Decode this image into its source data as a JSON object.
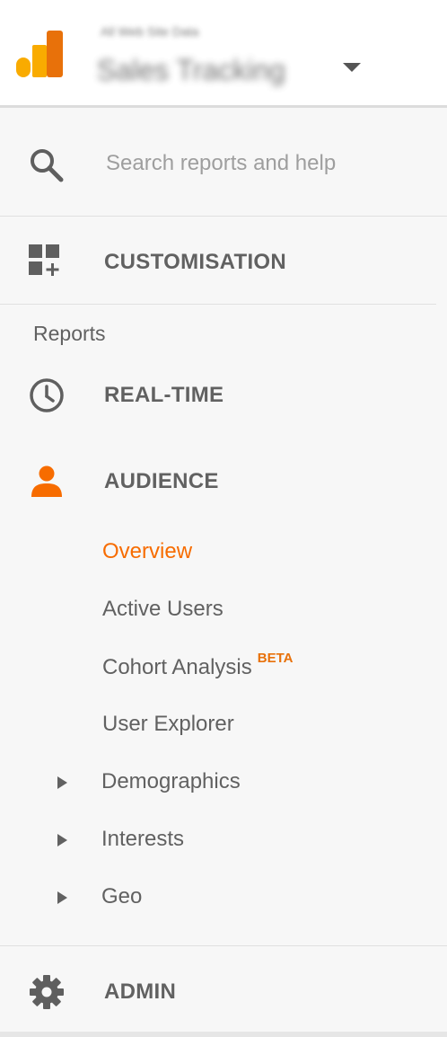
{
  "header": {
    "account_line": "All Web Site Data",
    "property_name": "Sales Tracking",
    "logo_icon": "analytics-logo-icon",
    "dropdown_icon": "caret-down-icon"
  },
  "search": {
    "placeholder": "Search reports and help",
    "icon": "search-icon"
  },
  "nav": {
    "customisation": {
      "label": "CUSTOMISATION",
      "icon": "dashboard-add-icon"
    },
    "reports_section": "Reports",
    "realtime": {
      "label": "REAL-TIME",
      "icon": "clock-icon"
    },
    "audience": {
      "label": "AUDIENCE",
      "icon": "person-icon",
      "items": [
        {
          "label": "Overview",
          "active": true
        },
        {
          "label": "Active Users"
        },
        {
          "label": "Cohort Analysis",
          "badge": "BETA"
        },
        {
          "label": "User Explorer"
        },
        {
          "label": "Demographics",
          "expandable": true
        },
        {
          "label": "Interests",
          "expandable": true
        },
        {
          "label": "Geo",
          "expandable": true
        }
      ]
    },
    "admin": {
      "label": "ADMIN",
      "icon": "gear-icon"
    }
  },
  "colors": {
    "accent": "#f76c00",
    "beta": "#e8710a",
    "text": "#616161",
    "logo_dark": "#e8710a",
    "logo_light": "#f9ab00"
  }
}
